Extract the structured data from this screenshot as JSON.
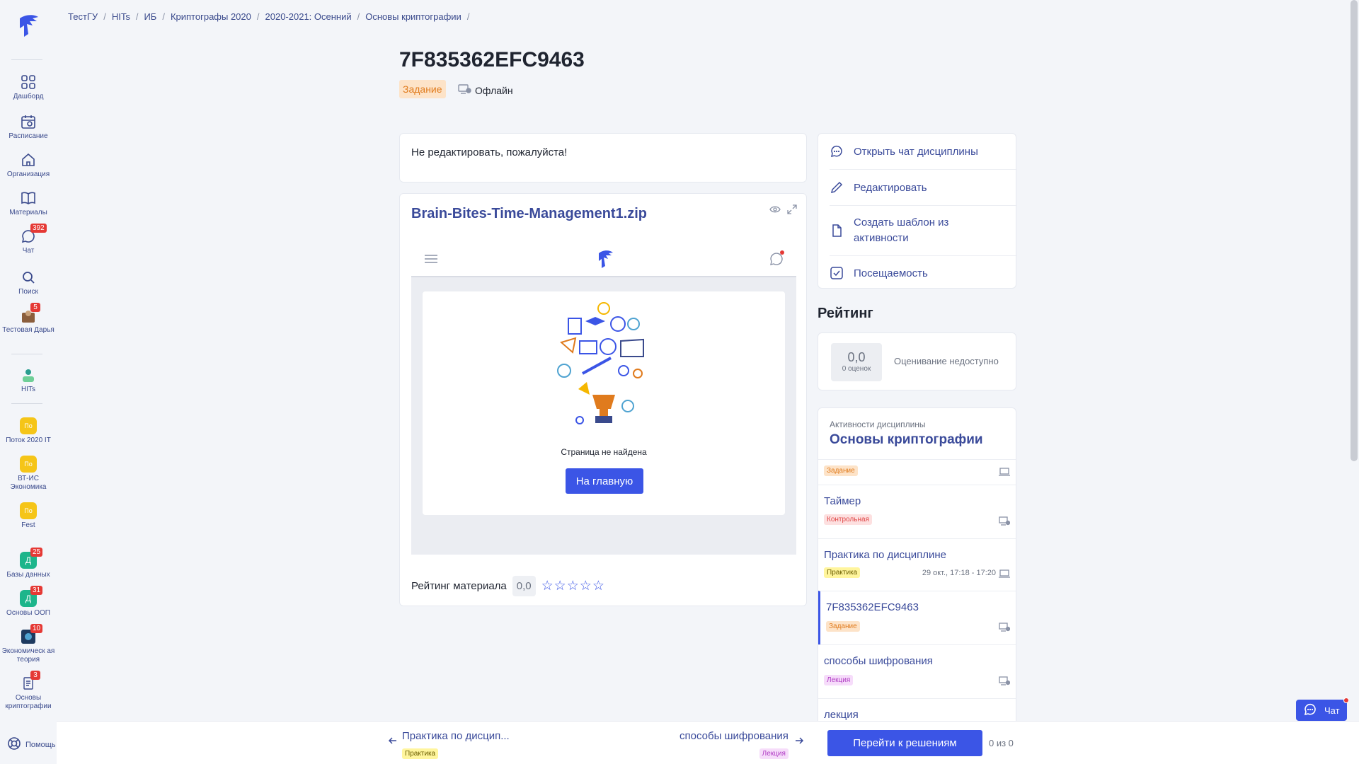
{
  "breadcrumb": [
    "ТестГУ",
    "HITs",
    "ИБ",
    "Криптографы 2020",
    "2020-2021: Осенний",
    "Основы криптографии"
  ],
  "sidebar": {
    "items": [
      {
        "label": "Дашборд"
      },
      {
        "label": "Расписание"
      },
      {
        "label": "Организация"
      },
      {
        "label": "Материалы"
      },
      {
        "label": "Чат",
        "badge": "392"
      },
      {
        "label": "Поиск"
      },
      {
        "label": "Тестовая Дарья",
        "badge": "5"
      },
      {
        "label": "HITs"
      },
      {
        "label": "Поток 2020 IT",
        "abbr": "По"
      },
      {
        "label": "ВТ-ИС Экономика",
        "abbr": "По"
      },
      {
        "label": "Fest",
        "abbr": "По"
      },
      {
        "label": "Базы данных",
        "abbr": "Д",
        "badge": "25"
      },
      {
        "label": "Основы ООП",
        "abbr": "Д",
        "badge": "31"
      },
      {
        "label": "Экономическ ая теория",
        "badge": "10"
      },
      {
        "label": "Основы криптографии",
        "badge": "3"
      }
    ],
    "help": "Помощь"
  },
  "header": {
    "title": "7F835362EFC9463",
    "type_tag": "Задание",
    "mode": "Офлайн"
  },
  "note": "Не редактировать, пожалуйста!",
  "file": {
    "name": "Brain-Bites-Time-Management1.zip",
    "not_found": "Страница не найдена",
    "home_button": "На главную",
    "rating_label": "Рейтинг материала",
    "rating_value": "0,0",
    "stars_total": 5,
    "stars_filled": 0
  },
  "actions": [
    {
      "label": "Открыть чат дисциплины",
      "icon": "chat-icon"
    },
    {
      "label": "Редактировать",
      "icon": "pencil-icon"
    },
    {
      "label": "Создать шаблон из активности",
      "icon": "document-icon"
    },
    {
      "label": "Посещаемость",
      "icon": "checkbox-icon"
    }
  ],
  "rating": {
    "heading": "Рейтинг",
    "value": "0,0",
    "count": "0 оценок",
    "note": "Оценивание недоступно"
  },
  "activities": {
    "subtitle": "Активности дисциплины",
    "title": "Основы криптографии",
    "items": [
      {
        "name": "",
        "tag": "Задание",
        "tag_color": "orange",
        "date": ""
      },
      {
        "name": "Таймер",
        "tag": "Контрольная",
        "tag_color": "red",
        "date": ""
      },
      {
        "name": "Практика по дисциплине",
        "tag": "Практика",
        "tag_color": "yellow",
        "date": "29 окт., 17:18 - 17:20"
      },
      {
        "name": "7F835362EFC9463",
        "tag": "Задание",
        "tag_color": "orange",
        "date": ""
      },
      {
        "name": "способы шифрования",
        "tag": "Лекция",
        "tag_color": "purple",
        "date": ""
      },
      {
        "name": "лекция",
        "tag": "",
        "tag_color": "",
        "date": ""
      }
    ]
  },
  "bottom": {
    "prev_label": "Практика по дисцип...",
    "prev_tag": "Практика",
    "next_label": "способы шифрования",
    "next_tag": "Лекция",
    "decisions_button": "Перейти к решениям",
    "counter": "0 из 0"
  },
  "chat_button": "Чат",
  "colors": {
    "accent": "#3b55e6",
    "link": "#3a4a9a",
    "badge": "#e53935"
  }
}
